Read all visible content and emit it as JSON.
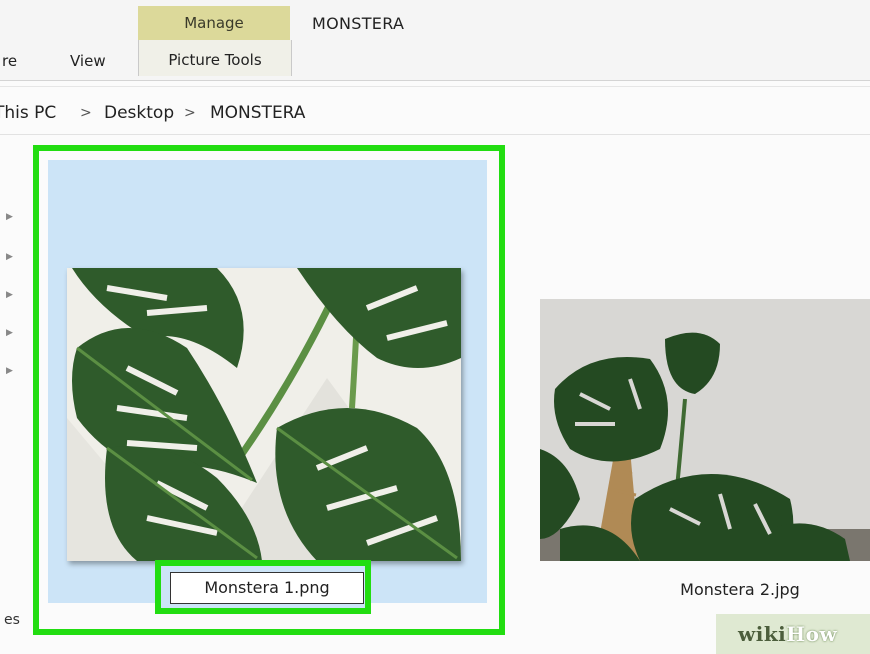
{
  "ribbon": {
    "contextual_tab": "Manage",
    "contextual_group": "Picture Tools",
    "window_title": "MONSTERA",
    "tabs": [
      "re",
      "View"
    ]
  },
  "address": {
    "crumbs": [
      "This PC",
      "Desktop",
      "MONSTERA"
    ],
    "separator": ">"
  },
  "nav_pane": {
    "partial_label": "es"
  },
  "files": [
    {
      "name": "Monstera 1.png",
      "selected": true,
      "renaming": true
    },
    {
      "name": "Monstera 2.jpg",
      "selected": false
    }
  ],
  "watermark": {
    "part1": "wiki",
    "part2": "How"
  },
  "colors": {
    "highlight": "#22dd11",
    "selection": "#cce4f7",
    "contextual_tab": "#dcd99a"
  }
}
